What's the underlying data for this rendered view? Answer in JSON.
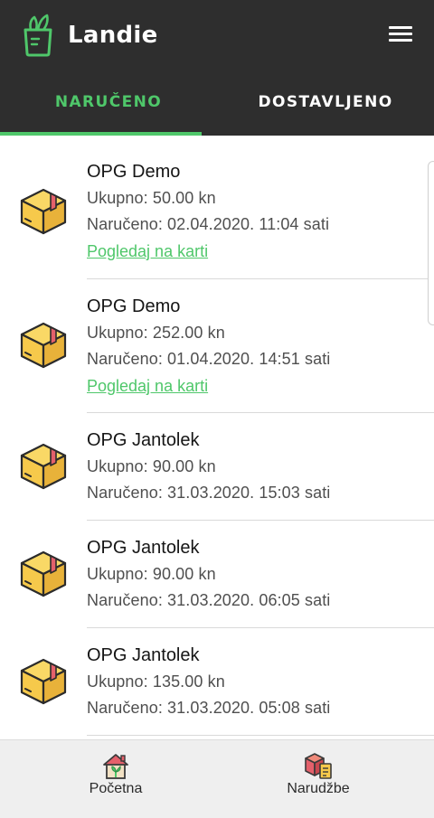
{
  "app": {
    "title": "Landie"
  },
  "tabs": [
    {
      "label": "NARUČENO",
      "active": true
    },
    {
      "label": "DOSTAVLJENO",
      "active": false
    }
  ],
  "orders": [
    {
      "farm": "OPG Demo",
      "total": "Ukupno: 50.00 kn",
      "ordered": "Naručeno: 02.04.2020. 11:04 sati",
      "map_link": "Pogledaj na karti"
    },
    {
      "farm": "OPG Demo",
      "total": "Ukupno: 252.00 kn",
      "ordered": "Naručeno: 01.04.2020. 14:51 sati",
      "map_link": "Pogledaj na karti"
    },
    {
      "farm": "OPG Jantolek",
      "total": "Ukupno: 90.00 kn",
      "ordered": "Naručeno: 31.03.2020. 15:03 sati"
    },
    {
      "farm": "OPG Jantolek",
      "total": "Ukupno: 90.00 kn",
      "ordered": "Naručeno: 31.03.2020. 06:05 sati"
    },
    {
      "farm": "OPG Jantolek",
      "total": "Ukupno: 135.00 kn",
      "ordered": "Naručeno: 31.03.2020. 05:08 sati"
    }
  ],
  "bottom_nav": [
    {
      "label": "Početna",
      "icon": "home-icon"
    },
    {
      "label": "Narudžbe",
      "icon": "orders-icon"
    }
  ],
  "colors": {
    "accent": "#4fc76a",
    "appbar": "#2e2e2e",
    "box": "#f6c94b",
    "box_tape": "#e4606b"
  },
  "icons": {
    "menu": "hamburger-menu-icon",
    "logo": "grocery-bag-icon",
    "order": "package-box-icon"
  }
}
